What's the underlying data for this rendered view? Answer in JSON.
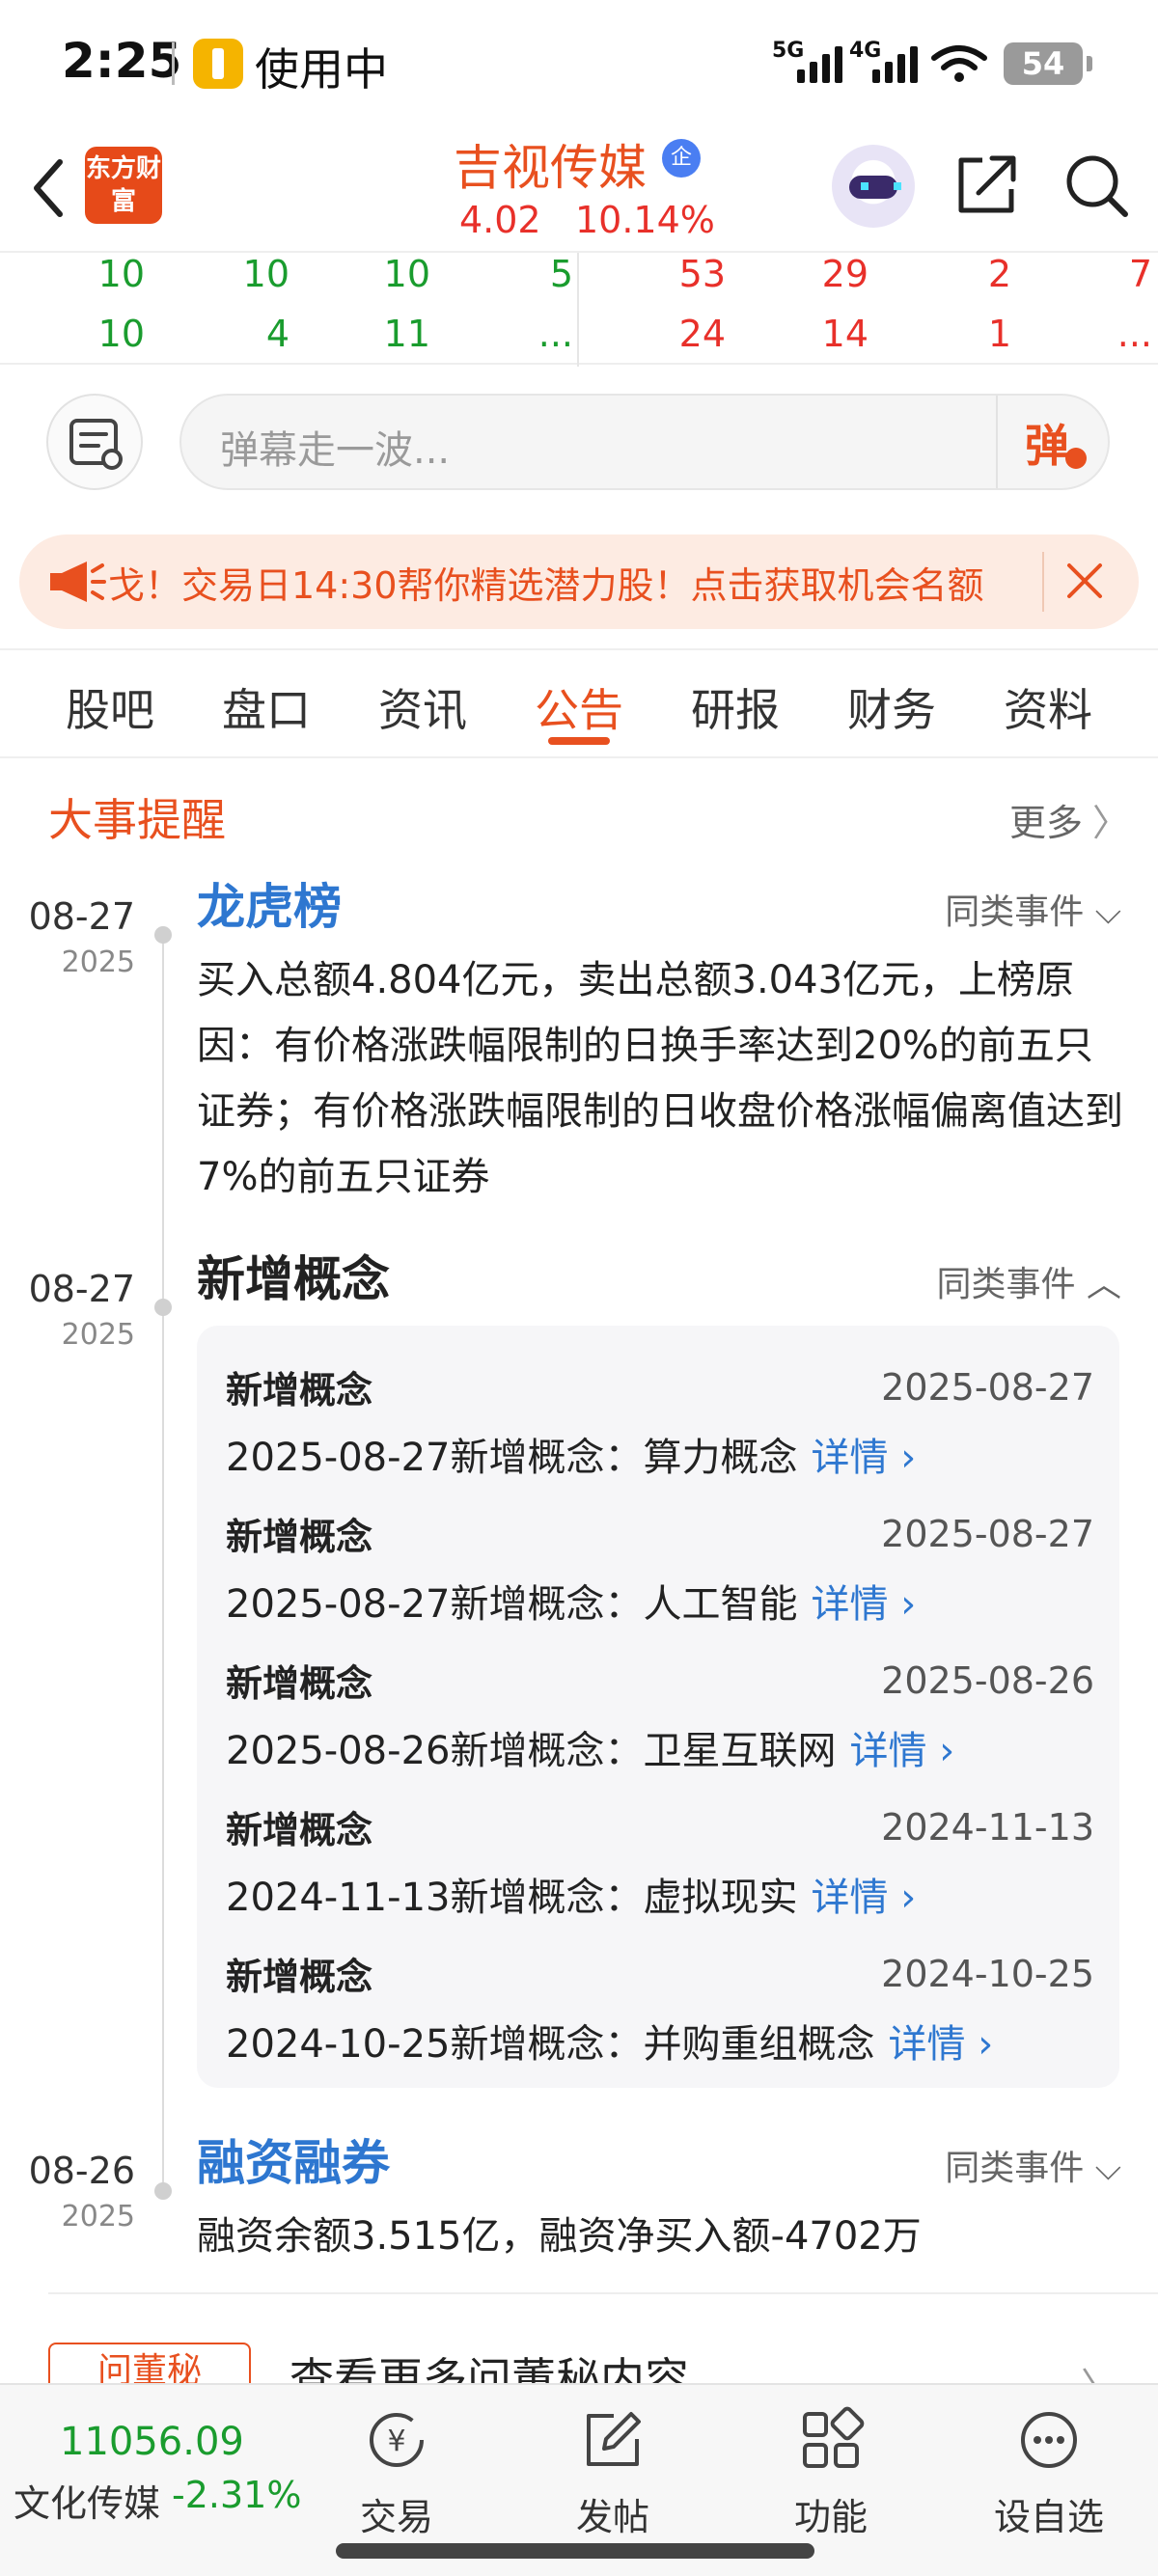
{
  "status_bar": {
    "time": "2:25",
    "in_use": "使用中",
    "network_5g": "5G",
    "network_4g": "4G",
    "battery": "54"
  },
  "header": {
    "logo_text": "东方财富",
    "stock_name": "吉视传媒",
    "corp_badge": "企",
    "price": "4.02",
    "change_pct": "10.14%"
  },
  "order_book": {
    "buy": [
      [
        "10",
        "10",
        "10",
        "5"
      ],
      [
        "10",
        "4",
        "11",
        "..."
      ]
    ],
    "sell": [
      [
        "53",
        "29",
        "2",
        "7"
      ],
      [
        "24",
        "14",
        "1",
        "..."
      ]
    ]
  },
  "danmaku": {
    "placeholder": "弹幕走一波...",
    "toggle": "弹"
  },
  "promo": {
    "text": "戈！交易日14:30帮你精选潜力股！点击获取机会名额"
  },
  "tabs": [
    {
      "label": "股吧"
    },
    {
      "label": "盘口"
    },
    {
      "label": "资讯"
    },
    {
      "label": "公告"
    },
    {
      "label": "研报"
    },
    {
      "label": "财务"
    },
    {
      "label": "资料"
    }
  ],
  "active_tab": "公告",
  "events": {
    "title": "大事提醒",
    "more": "更多",
    "similar_label": "同类事件",
    "items": [
      {
        "date": "08-27",
        "year": "2025",
        "title": "龙虎榜",
        "body": "买入总额4.804亿元，卖出总额3.043亿元，上榜原因：有价格涨跌幅限制的日换手率达到20%的前五只证券；有价格涨跌幅限制的日收盘价格涨幅偏离值达到7%的前五只证券"
      },
      {
        "date": "08-27",
        "year": "2025",
        "title": "新增概念",
        "concepts": [
          {
            "title": "新增概念",
            "date": "2025-08-27",
            "desc": "2025-08-27新增概念：算力概念",
            "detail": "详情"
          },
          {
            "title": "新增概念",
            "date": "2025-08-27",
            "desc": "2025-08-27新增概念：人工智能",
            "detail": "详情"
          },
          {
            "title": "新增概念",
            "date": "2025-08-26",
            "desc": "2025-08-26新增概念：卫星互联网",
            "detail": "详情"
          },
          {
            "title": "新增概念",
            "date": "2024-11-13",
            "desc": "2024-11-13新增概念：虚拟现实",
            "detail": "详情"
          },
          {
            "title": "新增概念",
            "date": "2024-10-25",
            "desc": "2024-10-25新增概念：并购重组概念",
            "detail": "详情"
          }
        ]
      },
      {
        "date": "08-26",
        "year": "2025",
        "title": "融资融券",
        "body": "融资余额3.515亿，融资净买入额-4702万"
      }
    ]
  },
  "secretary": {
    "tag": "问董秘",
    "text": "查看更多问董秘内容"
  },
  "bottom_bar": {
    "index_value": "11056.09",
    "index_name": "文化传媒",
    "index_change": "-2.31%",
    "items": [
      {
        "label": "交易"
      },
      {
        "label": "发帖"
      },
      {
        "label": "功能"
      },
      {
        "label": "设自选"
      }
    ]
  },
  "colors": {
    "accent": "#e8501f",
    "up": "#e8302a",
    "down": "#1a9c2e",
    "link": "#2e77d0"
  }
}
